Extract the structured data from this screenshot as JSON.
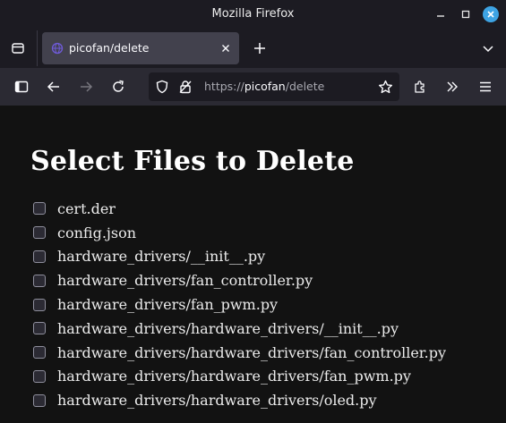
{
  "window": {
    "title": "Mozilla Firefox"
  },
  "tabs": [
    {
      "title": "picofan/delete",
      "active": true
    }
  ],
  "navbar": {
    "url_prefix": "https://",
    "url_host": "picofan",
    "url_path": "/delete"
  },
  "page": {
    "heading": "Select Files to Delete",
    "files": [
      {
        "name": "cert.der",
        "checked": false
      },
      {
        "name": "config.json",
        "checked": false
      },
      {
        "name": "hardware_drivers/__init__.py",
        "checked": false
      },
      {
        "name": "hardware_drivers/fan_controller.py",
        "checked": false
      },
      {
        "name": "hardware_drivers/fan_pwm.py",
        "checked": false
      },
      {
        "name": "hardware_drivers/hardware_drivers/__init__.py",
        "checked": false
      },
      {
        "name": "hardware_drivers/hardware_drivers/fan_controller.py",
        "checked": false
      },
      {
        "name": "hardware_drivers/hardware_drivers/fan_pwm.py",
        "checked": false
      },
      {
        "name": "hardware_drivers/hardware_drivers/oled.py",
        "checked": false
      }
    ]
  },
  "colors": {
    "accent": "#3da3e3",
    "tab_active": "#42414d",
    "toolbar": "#2b2a33",
    "page_bg": "#121212"
  },
  "icons": {
    "titlebar": [
      "minimize-icon",
      "maximize-icon",
      "close-icon"
    ],
    "tabstrip": [
      "tab-overview-icon",
      "tab-favicon-icon",
      "tab-close-icon",
      "new-tab-icon",
      "tab-list-chevron-icon"
    ],
    "navbar": [
      "sidebar-icon",
      "back-icon",
      "forward-icon",
      "reload-icon",
      "shield-icon",
      "lock-icon",
      "bookmark-star-icon",
      "extensions-icon",
      "overflow-icon",
      "menu-icon"
    ]
  }
}
